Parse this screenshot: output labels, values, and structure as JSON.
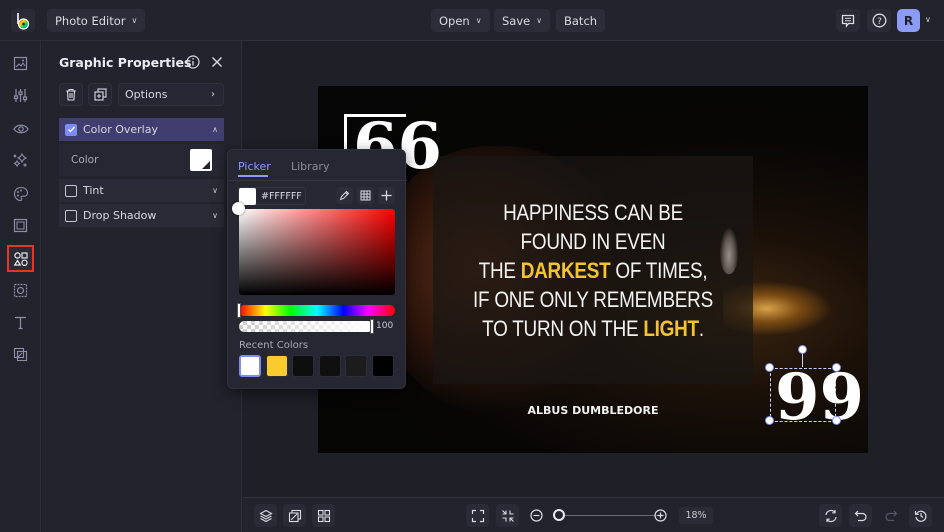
{
  "topbar": {
    "app_menu_label": "Photo Editor",
    "open_label": "Open",
    "save_label": "Save",
    "batch_label": "Batch",
    "avatar_initial": "R"
  },
  "sidebar": {
    "items": [
      {
        "name": "image-icon",
        "active": false
      },
      {
        "name": "adjustments-icon",
        "active": false
      },
      {
        "name": "eye-icon",
        "active": false
      },
      {
        "name": "effects-sparkle-icon",
        "active": false
      },
      {
        "name": "palette-icon",
        "active": false
      },
      {
        "name": "frame-icon",
        "active": false
      },
      {
        "name": "graphics-shapes-icon",
        "active": true
      },
      {
        "name": "texture-icon",
        "active": false
      },
      {
        "name": "text-icon",
        "active": false
      },
      {
        "name": "overlay-icon",
        "active": false
      }
    ]
  },
  "panel": {
    "title": "Graphic Properties",
    "options_label": "Options",
    "sections": [
      {
        "label": "Color Overlay",
        "checked": true,
        "expanded": true
      },
      {
        "label": "Tint",
        "checked": false,
        "expanded": false
      },
      {
        "label": "Drop Shadow",
        "checked": false,
        "expanded": false
      }
    ],
    "color_label": "Color",
    "color_value": "#FFFFFF"
  },
  "picker": {
    "tabs": [
      "Picker",
      "Library"
    ],
    "active_tab": "Picker",
    "hex": "#FFFFFF",
    "hue_fraction": 0.0,
    "alpha": "100",
    "recent_label": "Recent Colors",
    "recent_colors": [
      "#FFFFFF",
      "#F9CB2E",
      "#0E0E0E",
      "#101010",
      "#1C1C1C",
      "#000000"
    ]
  },
  "canvas": {
    "quote_lines": [
      {
        "pre": "HAPPINESS CAN BE",
        "hl": "",
        "post": ""
      },
      {
        "pre": "FOUND IN EVEN",
        "hl": "",
        "post": ""
      },
      {
        "pre": "THE ",
        "hl": "DARKEST",
        "post": " OF TIMES,"
      },
      {
        "pre": "IF ONE ONLY REMEMBERS",
        "hl": "",
        "post": ""
      },
      {
        "pre": "TO TURN ON THE ",
        "hl": "LIGHT",
        "post": "."
      }
    ],
    "author": "ALBUS DUMBLEDORE",
    "open_quote": "66",
    "close_quote": "99",
    "highlight_color": "#F4C430"
  },
  "bottombar": {
    "zoom_percent": "18%",
    "zoom_fraction": 0.0
  }
}
